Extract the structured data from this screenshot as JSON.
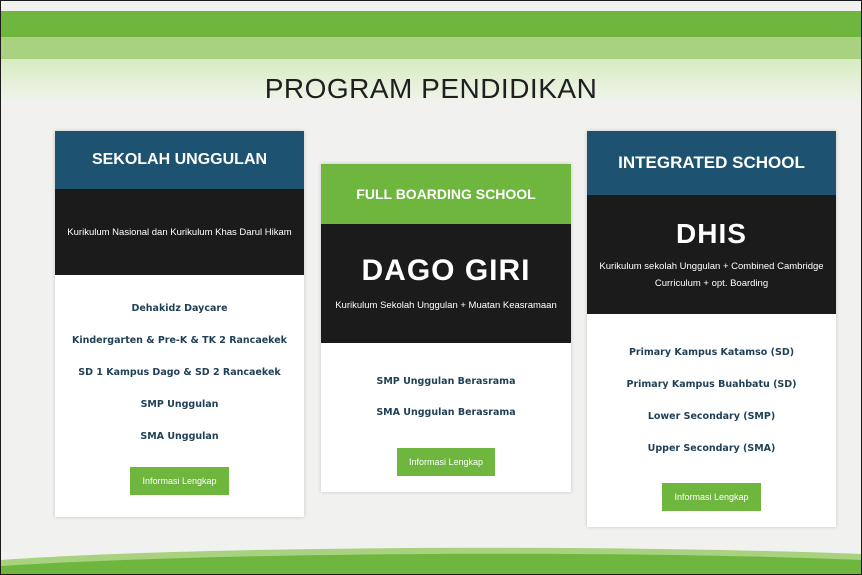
{
  "title": "PROGRAM PENDIDIKAN",
  "colors": {
    "navy": "#1d5270",
    "green": "#6fb63f",
    "dark": "#1c1b1b"
  },
  "cards": [
    {
      "header": "SEKOLAH UNGGULAN",
      "subtitle": "",
      "description": "Kurikulum Nasional dan Kurikulum Khas Darul Hikam",
      "items": [
        "Dehakidz Daycare",
        "Kindergarten & Pre-K & TK 2 Rancaekek",
        "SD 1 Kampus Dago & SD 2 Rancaekek",
        "SMP Unggulan",
        "SMA Unggulan"
      ],
      "button": "Informasi Lengkap"
    },
    {
      "header": "FULL BOARDING SCHOOL",
      "subtitle": "DAGO GIRI",
      "description": "Kurikulum Sekolah Unggulan + Muatan Keasramaan",
      "items": [
        "SMP Unggulan Berasrama",
        "SMA Unggulan Berasrama"
      ],
      "button": "Informasi Lengkap"
    },
    {
      "header": "INTEGRATED SCHOOL",
      "subtitle": "DHIS",
      "description": "Kurikulum sekolah Unggulan + Combined Cambridge Curriculum + opt. Boarding",
      "items": [
        "Primary Kampus Katamso (SD)",
        "Primary Kampus Buahbatu (SD)",
        "Lower Secondary (SMP)",
        "Upper Secondary (SMA)"
      ],
      "button": "Informasi Lengkap"
    }
  ]
}
